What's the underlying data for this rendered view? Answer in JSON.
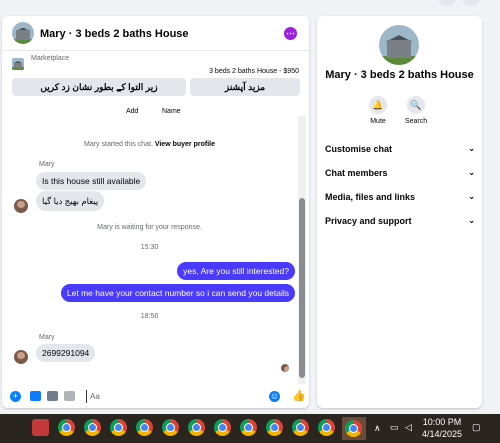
{
  "chat": {
    "title": "Mary · 3 beds 2 baths House",
    "more_icon": "more-icon",
    "marketplace_label": "Marketplace",
    "listing_text": "3 beds 2 baths House - $950",
    "action_left": "زیر التوا کے بطور نشان زد کریں",
    "action_right": "مزید آپشنز",
    "add_label": "Add",
    "name_label": "Name",
    "system_start_prefix": "Mary started this chat.",
    "system_start_link": "View buyer profile",
    "sender_name": "Mary",
    "msg1": "Is this house still available",
    "msg2": "پیغام بھیج دیا گیا",
    "system_waiting": "Mary is waiting for your response.",
    "time1": "15:30",
    "msg3": "yes, Are you still interested?",
    "msg4": "Let me have your contact number so i can send you details",
    "time2": "18:56",
    "sender_name2": "Mary",
    "msg5": "2699291094",
    "composer_placeholder": "Aa"
  },
  "side": {
    "title": "Mary · 3 beds 2 baths House",
    "mute_label": "Mute",
    "search_label": "Search",
    "sections": [
      "Customise chat",
      "Chat members",
      "Media, files and links",
      "Privacy and support"
    ]
  },
  "taskbar": {
    "time": "10:00 PM",
    "date": "4/14/2025"
  },
  "colors": {
    "accent": "#0a7cff",
    "outgoing_bubble": "#4a3aff",
    "more_dot": "#9d1fe0",
    "taskbar": "#2b2520"
  }
}
